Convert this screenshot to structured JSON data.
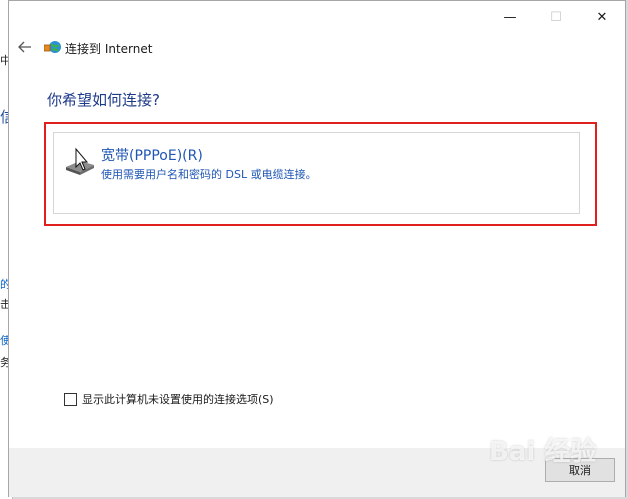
{
  "window": {
    "title": "连接到 Internet",
    "minimize_glyph": "—",
    "maximize_glyph": "☐",
    "close_glyph": "✕"
  },
  "background_window": {
    "fragments": [
      "中",
      "信",
      "的",
      "击",
      "使",
      "务"
    ]
  },
  "main": {
    "question": "你希望如何连接?",
    "option": {
      "title": "宽带(PPPoE)(R)",
      "description": "使用需要用户名和密码的 DSL 或电缆连接。",
      "icon": "broadband-modem-icon"
    },
    "checkbox": {
      "label": "显示此计算机未设置使用的连接选项(S)",
      "checked": false
    }
  },
  "footer": {
    "cancel_label": "取消"
  },
  "watermark": "Bai 经验",
  "colors": {
    "accent_text": "#1f56b5",
    "heading": "#1e3a8a",
    "highlight": "#e0201c"
  }
}
